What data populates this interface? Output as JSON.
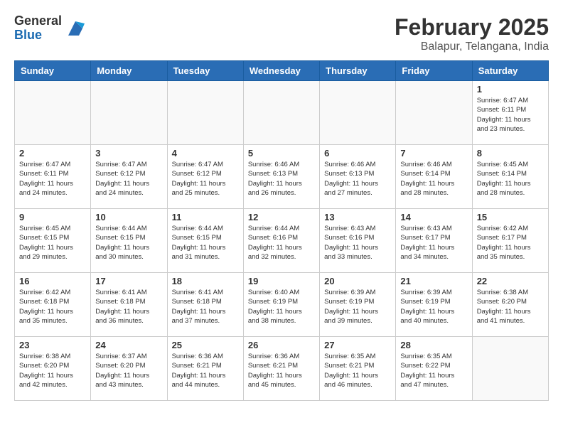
{
  "logo": {
    "general": "General",
    "blue": "Blue"
  },
  "title": "February 2025",
  "location": "Balapur, Telangana, India",
  "weekdays": [
    "Sunday",
    "Monday",
    "Tuesday",
    "Wednesday",
    "Thursday",
    "Friday",
    "Saturday"
  ],
  "weeks": [
    [
      {
        "day": "",
        "info": ""
      },
      {
        "day": "",
        "info": ""
      },
      {
        "day": "",
        "info": ""
      },
      {
        "day": "",
        "info": ""
      },
      {
        "day": "",
        "info": ""
      },
      {
        "day": "",
        "info": ""
      },
      {
        "day": "1",
        "info": "Sunrise: 6:47 AM\nSunset: 6:11 PM\nDaylight: 11 hours\nand 23 minutes."
      }
    ],
    [
      {
        "day": "2",
        "info": "Sunrise: 6:47 AM\nSunset: 6:11 PM\nDaylight: 11 hours\nand 24 minutes."
      },
      {
        "day": "3",
        "info": "Sunrise: 6:47 AM\nSunset: 6:12 PM\nDaylight: 11 hours\nand 24 minutes."
      },
      {
        "day": "4",
        "info": "Sunrise: 6:47 AM\nSunset: 6:12 PM\nDaylight: 11 hours\nand 25 minutes."
      },
      {
        "day": "5",
        "info": "Sunrise: 6:46 AM\nSunset: 6:13 PM\nDaylight: 11 hours\nand 26 minutes."
      },
      {
        "day": "6",
        "info": "Sunrise: 6:46 AM\nSunset: 6:13 PM\nDaylight: 11 hours\nand 27 minutes."
      },
      {
        "day": "7",
        "info": "Sunrise: 6:46 AM\nSunset: 6:14 PM\nDaylight: 11 hours\nand 28 minutes."
      },
      {
        "day": "8",
        "info": "Sunrise: 6:45 AM\nSunset: 6:14 PM\nDaylight: 11 hours\nand 28 minutes."
      }
    ],
    [
      {
        "day": "9",
        "info": "Sunrise: 6:45 AM\nSunset: 6:15 PM\nDaylight: 11 hours\nand 29 minutes."
      },
      {
        "day": "10",
        "info": "Sunrise: 6:44 AM\nSunset: 6:15 PM\nDaylight: 11 hours\nand 30 minutes."
      },
      {
        "day": "11",
        "info": "Sunrise: 6:44 AM\nSunset: 6:15 PM\nDaylight: 11 hours\nand 31 minutes."
      },
      {
        "day": "12",
        "info": "Sunrise: 6:44 AM\nSunset: 6:16 PM\nDaylight: 11 hours\nand 32 minutes."
      },
      {
        "day": "13",
        "info": "Sunrise: 6:43 AM\nSunset: 6:16 PM\nDaylight: 11 hours\nand 33 minutes."
      },
      {
        "day": "14",
        "info": "Sunrise: 6:43 AM\nSunset: 6:17 PM\nDaylight: 11 hours\nand 34 minutes."
      },
      {
        "day": "15",
        "info": "Sunrise: 6:42 AM\nSunset: 6:17 PM\nDaylight: 11 hours\nand 35 minutes."
      }
    ],
    [
      {
        "day": "16",
        "info": "Sunrise: 6:42 AM\nSunset: 6:18 PM\nDaylight: 11 hours\nand 35 minutes."
      },
      {
        "day": "17",
        "info": "Sunrise: 6:41 AM\nSunset: 6:18 PM\nDaylight: 11 hours\nand 36 minutes."
      },
      {
        "day": "18",
        "info": "Sunrise: 6:41 AM\nSunset: 6:18 PM\nDaylight: 11 hours\nand 37 minutes."
      },
      {
        "day": "19",
        "info": "Sunrise: 6:40 AM\nSunset: 6:19 PM\nDaylight: 11 hours\nand 38 minutes."
      },
      {
        "day": "20",
        "info": "Sunrise: 6:39 AM\nSunset: 6:19 PM\nDaylight: 11 hours\nand 39 minutes."
      },
      {
        "day": "21",
        "info": "Sunrise: 6:39 AM\nSunset: 6:19 PM\nDaylight: 11 hours\nand 40 minutes."
      },
      {
        "day": "22",
        "info": "Sunrise: 6:38 AM\nSunset: 6:20 PM\nDaylight: 11 hours\nand 41 minutes."
      }
    ],
    [
      {
        "day": "23",
        "info": "Sunrise: 6:38 AM\nSunset: 6:20 PM\nDaylight: 11 hours\nand 42 minutes."
      },
      {
        "day": "24",
        "info": "Sunrise: 6:37 AM\nSunset: 6:20 PM\nDaylight: 11 hours\nand 43 minutes."
      },
      {
        "day": "25",
        "info": "Sunrise: 6:36 AM\nSunset: 6:21 PM\nDaylight: 11 hours\nand 44 minutes."
      },
      {
        "day": "26",
        "info": "Sunrise: 6:36 AM\nSunset: 6:21 PM\nDaylight: 11 hours\nand 45 minutes."
      },
      {
        "day": "27",
        "info": "Sunrise: 6:35 AM\nSunset: 6:21 PM\nDaylight: 11 hours\nand 46 minutes."
      },
      {
        "day": "28",
        "info": "Sunrise: 6:35 AM\nSunset: 6:22 PM\nDaylight: 11 hours\nand 47 minutes."
      },
      {
        "day": "",
        "info": ""
      }
    ]
  ]
}
